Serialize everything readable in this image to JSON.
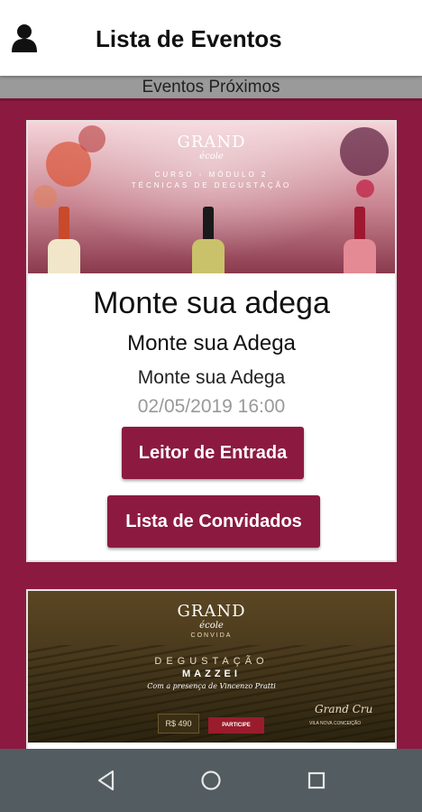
{
  "app": {
    "title": "Lista de Eventos"
  },
  "section": {
    "label": "Eventos Próximos"
  },
  "events": [
    {
      "banner": {
        "brand": "GRAND",
        "brand_sub": "école",
        "line1": "CURSO - MÓDULO 2",
        "line2": "TÉCNICAS DE DEGUSTAÇÃO"
      },
      "title": "Monte sua adega",
      "subtitle": "Monte sua Adega",
      "description": "Monte sua Adega",
      "datetime": "02/05/2019 16:00",
      "buttons": {
        "entry": "Leitor de Entrada",
        "guests": "Lista de Convidados"
      }
    },
    {
      "banner": {
        "brand": "GRAND",
        "brand_sub": "école",
        "convida": "CONVIDA",
        "line1": "DEGUSTAÇÃO",
        "line2": "MAZZEI",
        "line3": "Com a presença de Vincenzo Pratti",
        "price": "R$ 490",
        "cta": "PARTICIPE",
        "venue": "Grand Cru",
        "venue_sub": "VILA NOVA CONCEIÇÃO"
      }
    }
  ],
  "colors": {
    "primary": "#8c1a40",
    "header_bg": "#ffffff",
    "section_bg": "#9a9a9a",
    "navbar_bg": "#535c60"
  },
  "icons": {
    "profile": "person-icon",
    "back": "back-triangle-icon",
    "home": "home-circle-icon",
    "recents": "recents-square-icon"
  }
}
